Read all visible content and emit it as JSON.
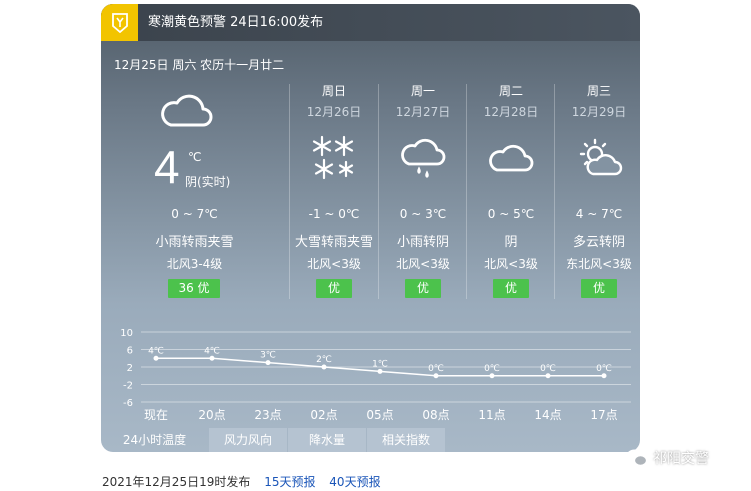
{
  "alert": {
    "text": "寒潮黄色预警 24日16:00发布",
    "icon": "cold-wave-alert-icon",
    "color": "#f2c400"
  },
  "today": {
    "date_line": "12月25日 周六 农历十一月廿二",
    "temp": "4",
    "unit": "℃",
    "condition": "阴(实时)",
    "range": "0 ~ 7℃",
    "weather": "小雨转雨夹雪",
    "wind": "北风3-4级",
    "aqi": "36 优",
    "icon": "cloudy-icon"
  },
  "forecast": [
    {
      "day": "周日",
      "date": "12月26日",
      "range": "-1 ~ 0℃",
      "weather": "大雪转雨夹雪",
      "wind": "北风<3级",
      "aqi": "优",
      "icon": "heavy-snow-icon"
    },
    {
      "day": "周一",
      "date": "12月27日",
      "range": "0 ~ 3℃",
      "weather": "小雨转阴",
      "wind": "北风<3级",
      "aqi": "优",
      "icon": "light-rain-icon"
    },
    {
      "day": "周二",
      "date": "12月28日",
      "range": "0 ~ 5℃",
      "weather": "阴",
      "wind": "北风<3级",
      "aqi": "优",
      "icon": "cloudy-icon"
    },
    {
      "day": "周三",
      "date": "12月29日",
      "range": "4 ~ 7℃",
      "weather": "多云转阴",
      "wind": "东北风<3级",
      "aqi": "优",
      "icon": "partly-cloudy-icon"
    }
  ],
  "chart_data": {
    "type": "line",
    "categories": [
      "现在",
      "20点",
      "23点",
      "02点",
      "05点",
      "08点",
      "11点",
      "14点",
      "17点"
    ],
    "values": [
      4,
      4,
      3,
      2,
      1,
      0,
      0,
      0,
      0
    ],
    "labels": [
      "4℃",
      "4℃",
      "3℃",
      "2℃",
      "1℃",
      "0℃",
      "0℃",
      "0℃",
      "0℃"
    ],
    "yticks": [
      "10",
      "6",
      "2",
      "-2",
      "-6"
    ],
    "ylim": [
      -6,
      10
    ],
    "grid": true
  },
  "tabs": [
    "24小时温度",
    "风力风向",
    "降水量",
    "相关指数"
  ],
  "footer": {
    "published": "2021年12月25日19时发布",
    "link1": "15天预报",
    "link2": "40天预报"
  },
  "watermark": "祁阳交警",
  "colors": {
    "aqi_good": "#4cc24c",
    "link": "#1a55b8"
  }
}
